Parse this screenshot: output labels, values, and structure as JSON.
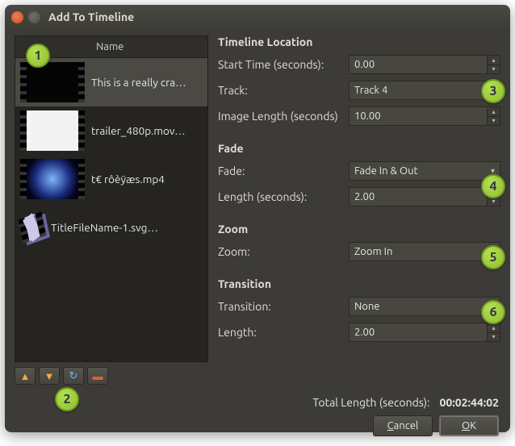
{
  "window": {
    "title": "Add To Timeline"
  },
  "filelist": {
    "header": "Name",
    "items": [
      {
        "thumb": "dark",
        "name": "This is a really cra…"
      },
      {
        "thumb": "white",
        "name": "trailer_480p.mov…"
      },
      {
        "thumb": "globe",
        "name": "t€ rôèÿæs.mp4"
      },
      {
        "thumb": "cube",
        "name": "TitleFileName-1.svg…"
      }
    ]
  },
  "sections": {
    "timeline": {
      "title": "Timeline Location",
      "start_label": "Start Time (seconds):",
      "start_value": "0.00",
      "track_label": "Track:",
      "track_value": "Track 4",
      "imglen_label": "Image Length (seconds)",
      "imglen_value": "10.00"
    },
    "fade": {
      "title": "Fade",
      "fade_label": "Fade:",
      "fade_value": "Fade In & Out",
      "len_label": "Length (seconds):",
      "len_value": "2.00"
    },
    "zoom": {
      "title": "Zoom",
      "zoom_label": "Zoom:",
      "zoom_value": "Zoom In"
    },
    "transition": {
      "title": "Transition",
      "trans_label": "Transition:",
      "trans_value": "None",
      "len_label": "Length:",
      "len_value": "2.00"
    }
  },
  "footer": {
    "total_label": "Total Length (seconds):",
    "total_value": "00:02:44:02",
    "cancel": "Cancel",
    "ok": "OK"
  },
  "badges": [
    "1",
    "2",
    "3",
    "4",
    "5",
    "6"
  ]
}
